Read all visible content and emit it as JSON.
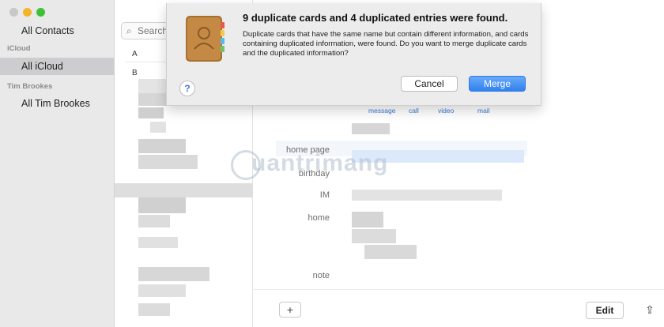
{
  "window": {
    "traffic_lights": [
      "#c8c8c8",
      "#f5b428",
      "#3ec235"
    ]
  },
  "sidebar": {
    "all_contacts": "All Contacts",
    "groups": [
      {
        "header": "iCloud",
        "item": "All iCloud",
        "selected": true
      },
      {
        "header": "Tim Brookes",
        "item": "All Tim Brookes",
        "selected": false
      }
    ]
  },
  "list": {
    "search_placeholder": "Search",
    "letters": [
      "A",
      "B"
    ]
  },
  "detail": {
    "actions": [
      "message",
      "call",
      "video",
      "mail"
    ],
    "fields": [
      "home page",
      "birthday",
      "IM",
      "home",
      "note"
    ],
    "add_label": "+",
    "edit_label": "Edit"
  },
  "dialog": {
    "title": "9 duplicate cards and 4 duplicated entries were found.",
    "message": "Duplicate cards that have the same name but contain different information, and cards containing duplicated information, were found. Do you want to merge duplicate cards and the duplicated information?",
    "cancel_label": "Cancel",
    "merge_label": "Merge",
    "help_label": "?",
    "icon": "address-book-icon"
  },
  "watermark": {
    "text": "uantrimang"
  },
  "colors": {
    "accent": "#2f80ee",
    "selection": "#cdcdcf",
    "sidebar": "#e9e9ea"
  }
}
